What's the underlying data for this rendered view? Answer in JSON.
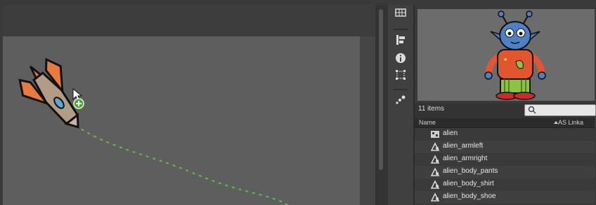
{
  "library": {
    "item_count": "11 items",
    "search_placeholder": "",
    "columns": {
      "name": "Name",
      "linkage": "AS Linka"
    },
    "items": [
      {
        "label": "alien",
        "icon": "movieclip-symbol-icon"
      },
      {
        "label": "alien_armleft",
        "icon": "graphic-symbol-icon"
      },
      {
        "label": "alien_armright",
        "icon": "graphic-symbol-icon"
      },
      {
        "label": "alien_body_pants",
        "icon": "graphic-symbol-icon"
      },
      {
        "label": "alien_body_shirt",
        "icon": "graphic-symbol-icon"
      },
      {
        "label": "alien_body_shoe",
        "icon": "graphic-symbol-icon"
      }
    ]
  },
  "tools": [
    "library-icon",
    "align-icon",
    "info-icon",
    "transform-icon",
    "motion-presets-icon"
  ],
  "colors": {
    "stage": "#5e5e5e",
    "motion_path": "#7ed957",
    "panel_bg": "#3a3a3a",
    "add_badge": "#4aa83a"
  }
}
